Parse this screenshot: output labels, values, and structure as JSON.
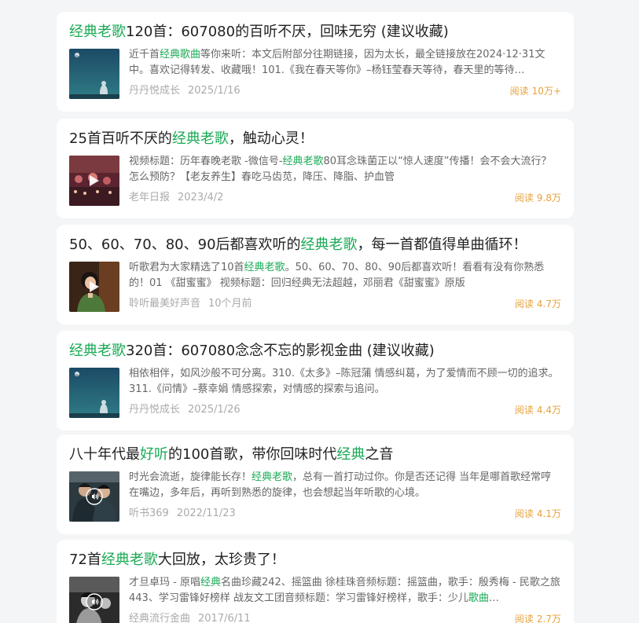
{
  "reads_label": "阅读",
  "colors": {
    "highlight": "#1aaa55",
    "reads": "#e8a23a",
    "meta": "#aaaaaa",
    "summary": "#666666"
  },
  "items": [
    {
      "title_parts": [
        {
          "text": "经典老歌",
          "hl": true
        },
        {
          "text": "120首：607080的百听不厌，回味无穷 (建议收藏)",
          "hl": false
        }
      ],
      "summary_parts": [
        {
          "text": "近千首",
          "hl": false
        },
        {
          "text": "经典歌曲",
          "hl": true
        },
        {
          "text": "等你来听：本文后附部分往期链接，因为太长，最全链接放在2024·12·31文中。喜欢记得转发、收藏哦！101.《我在春天等你》–杨钰莹春天等待，春天里的等待…",
          "hl": false
        }
      ],
      "source": "丹丹悦成长",
      "date": "2025/1/16",
      "reads": "10万+",
      "thumb": "night-sky",
      "badge": ""
    },
    {
      "title_parts": [
        {
          "text": "25首百听不厌的",
          "hl": false
        },
        {
          "text": "经典老歌",
          "hl": true
        },
        {
          "text": "，触动心灵！",
          "hl": false
        }
      ],
      "summary_parts": [
        {
          "text": "视频标题：历年春晚老歌 -微信号-",
          "hl": false
        },
        {
          "text": "经典老歌",
          "hl": true
        },
        {
          "text": "80耳念珠菌正以“惊人速度”传播！会不会大流行？怎么预防？【老友养生】春吃马齿苋，降压、降脂、护血管",
          "hl": false
        }
      ],
      "source": "老年日报",
      "date": "2023/4/2",
      "reads": "9.8万",
      "thumb": "stage",
      "badge": "play"
    },
    {
      "title_parts": [
        {
          "text": "50、60、70、80、90后都喜欢听的",
          "hl": false
        },
        {
          "text": "经典老歌",
          "hl": true
        },
        {
          "text": "，每一首都值得单曲循环！",
          "hl": false
        }
      ],
      "summary_parts": [
        {
          "text": "听歌君为大家精选了10首",
          "hl": false
        },
        {
          "text": "经典老歌",
          "hl": true
        },
        {
          "text": "。50、60、70、80、90后都喜欢听！看看有没有你熟悉的！01 《甜蜜蜜》 视频标题：回归经典无法超越，邓丽君《甜蜜蜜》原版",
          "hl": false
        }
      ],
      "source": "聆听最美好声音",
      "date": "10个月前",
      "reads": "4.7万",
      "thumb": "portrait",
      "badge": "play"
    },
    {
      "title_parts": [
        {
          "text": "经典老歌",
          "hl": true
        },
        {
          "text": "320首：607080念念不忘的影视金曲 (建议收藏)",
          "hl": false
        }
      ],
      "summary_parts": [
        {
          "text": "相依相伴，如风沙般不可分离。310.《太多》–陈冠蒲 情感纠葛，为了爱情而不顾一切的追求。311.《问情》–蔡幸娟 情感探索，对情感的探索与追问。",
          "hl": false
        }
      ],
      "source": "丹丹悦成长",
      "date": "2025/1/26",
      "reads": "4.4万",
      "thumb": "night-sky",
      "badge": ""
    },
    {
      "title_parts": [
        {
          "text": "八十年代最",
          "hl": false
        },
        {
          "text": "好听",
          "hl": true
        },
        {
          "text": "的100首歌，带你回味时代",
          "hl": false
        },
        {
          "text": "经典",
          "hl": true
        },
        {
          "text": "之音",
          "hl": false
        }
      ],
      "summary_parts": [
        {
          "text": "时光会流逝，旋律能长存！",
          "hl": false
        },
        {
          "text": "经典老歌",
          "hl": true
        },
        {
          "text": "，总有一首打动过你。你是否还记得 当年是哪首歌经常哼在嘴边，多年后，再听到熟悉的旋律，也会想起当年听歌的心境。",
          "hl": false
        }
      ],
      "source": "听书369",
      "date": "2022/11/23",
      "reads": "4.1万",
      "thumb": "duo",
      "badge": "audio"
    },
    {
      "title_parts": [
        {
          "text": "72首",
          "hl": false
        },
        {
          "text": "经典老歌",
          "hl": true
        },
        {
          "text": "大回放，太珍贵了！",
          "hl": false
        }
      ],
      "summary_parts": [
        {
          "text": "才旦卓玛 - 原唱",
          "hl": false
        },
        {
          "text": "经典",
          "hl": true
        },
        {
          "text": "名曲珍藏242、摇篮曲 徐桂珠音频标题：摇篮曲，歌手：殷秀梅 - 民歌之旅443、学习雷锋好榜样 战友文工团音频标题：学习雷锋好榜样，歌手：少儿",
          "hl": false
        },
        {
          "text": "歌曲",
          "hl": true
        },
        {
          "text": "…",
          "hl": false
        }
      ],
      "source": "经典流行金曲",
      "date": "2017/6/11",
      "reads": "2.7万",
      "thumb": "bw",
      "badge": "audio"
    }
  ]
}
